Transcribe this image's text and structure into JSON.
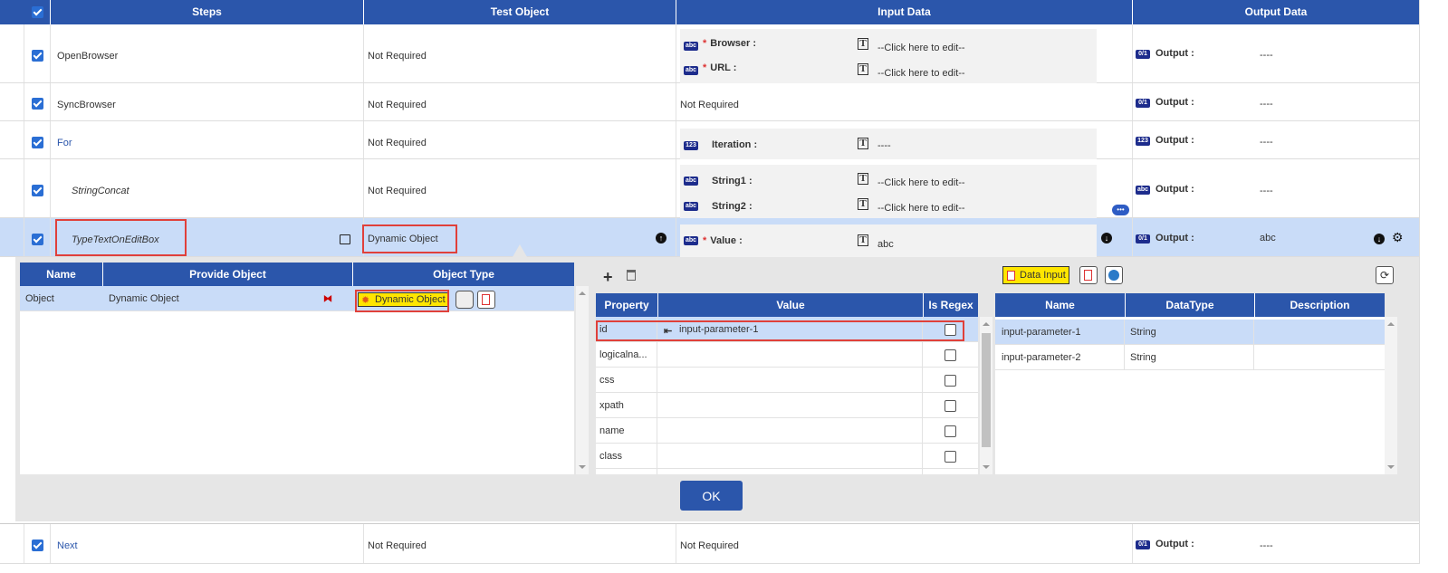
{
  "header": {
    "steps": "Steps",
    "test_object": "Test Object",
    "input_data": "Input Data",
    "output_data": "Output Data"
  },
  "rows": [
    {
      "step": "OpenBrowser",
      "test_object": "Not Required",
      "inputs": [
        {
          "tag": "abc",
          "name": "Browser :",
          "value": "--Click here to edit--"
        },
        {
          "tag": "abc",
          "name": "URL :",
          "value": "--Click here to edit--"
        }
      ],
      "output": {
        "tag": "0/1",
        "label": "Output :",
        "value": "----"
      }
    },
    {
      "step": "SyncBrowser",
      "test_object": "Not Required",
      "input_text": "Not Required",
      "output": {
        "tag": "0/1",
        "label": "Output :",
        "value": "----"
      }
    },
    {
      "step": "For",
      "test_object": "Not Required",
      "inputs": [
        {
          "tag": "123",
          "name": "Iteration :",
          "value": "----"
        }
      ],
      "output": {
        "tag": "123",
        "label": "Output :",
        "value": "----"
      }
    },
    {
      "step": "StringConcat",
      "test_object": "Not Required",
      "inputs": [
        {
          "tag": "abc",
          "name": "String1 :",
          "value": "--Click here to edit--"
        },
        {
          "tag": "abc",
          "name": "String2 :",
          "value": "--Click here to edit--"
        }
      ],
      "more": "•••",
      "output": {
        "tag": "abc",
        "label": "Output :",
        "value": "----"
      }
    },
    {
      "step": "TypeTextOnEditBox",
      "test_object": "Dynamic Object",
      "inputs": [
        {
          "tag": "abc",
          "name": "Value :",
          "value": "abc"
        }
      ],
      "output": {
        "tag": "0/1",
        "label": "Output :",
        "value": "abc"
      }
    },
    {
      "step": "Next",
      "test_object": "Not Required",
      "input_text": "Not Required",
      "output": {
        "tag": "0/1",
        "label": "Output :",
        "value": "----"
      }
    }
  ],
  "object_grid": {
    "headers": [
      "Name",
      "Provide Object",
      "Object Type"
    ],
    "row": {
      "name": "Object",
      "provide": "Dynamic Object",
      "type": "Dynamic Object"
    }
  },
  "property_grid": {
    "headers": [
      "Property",
      "Value",
      "Is Regex"
    ],
    "rows": [
      {
        "property": "id",
        "value": "input-parameter-1"
      },
      {
        "property": "logicalna...",
        "value": ""
      },
      {
        "property": "css",
        "value": ""
      },
      {
        "property": "xpath",
        "value": ""
      },
      {
        "property": "name",
        "value": ""
      },
      {
        "property": "class",
        "value": ""
      }
    ]
  },
  "param_grid": {
    "data_input_label": "Data Input",
    "headers": [
      "Name",
      "DataType",
      "Description"
    ],
    "rows": [
      {
        "name": "input-parameter-1",
        "type": "String",
        "desc": ""
      },
      {
        "name": "input-parameter-2",
        "type": "String",
        "desc": ""
      }
    ]
  },
  "ok_label": "OK",
  "colors": {
    "header_blue": "#2b56ab",
    "selected_row": "#c9dcf8",
    "highlight_red": "#e0403a",
    "yellow_button": "#ffe600"
  }
}
